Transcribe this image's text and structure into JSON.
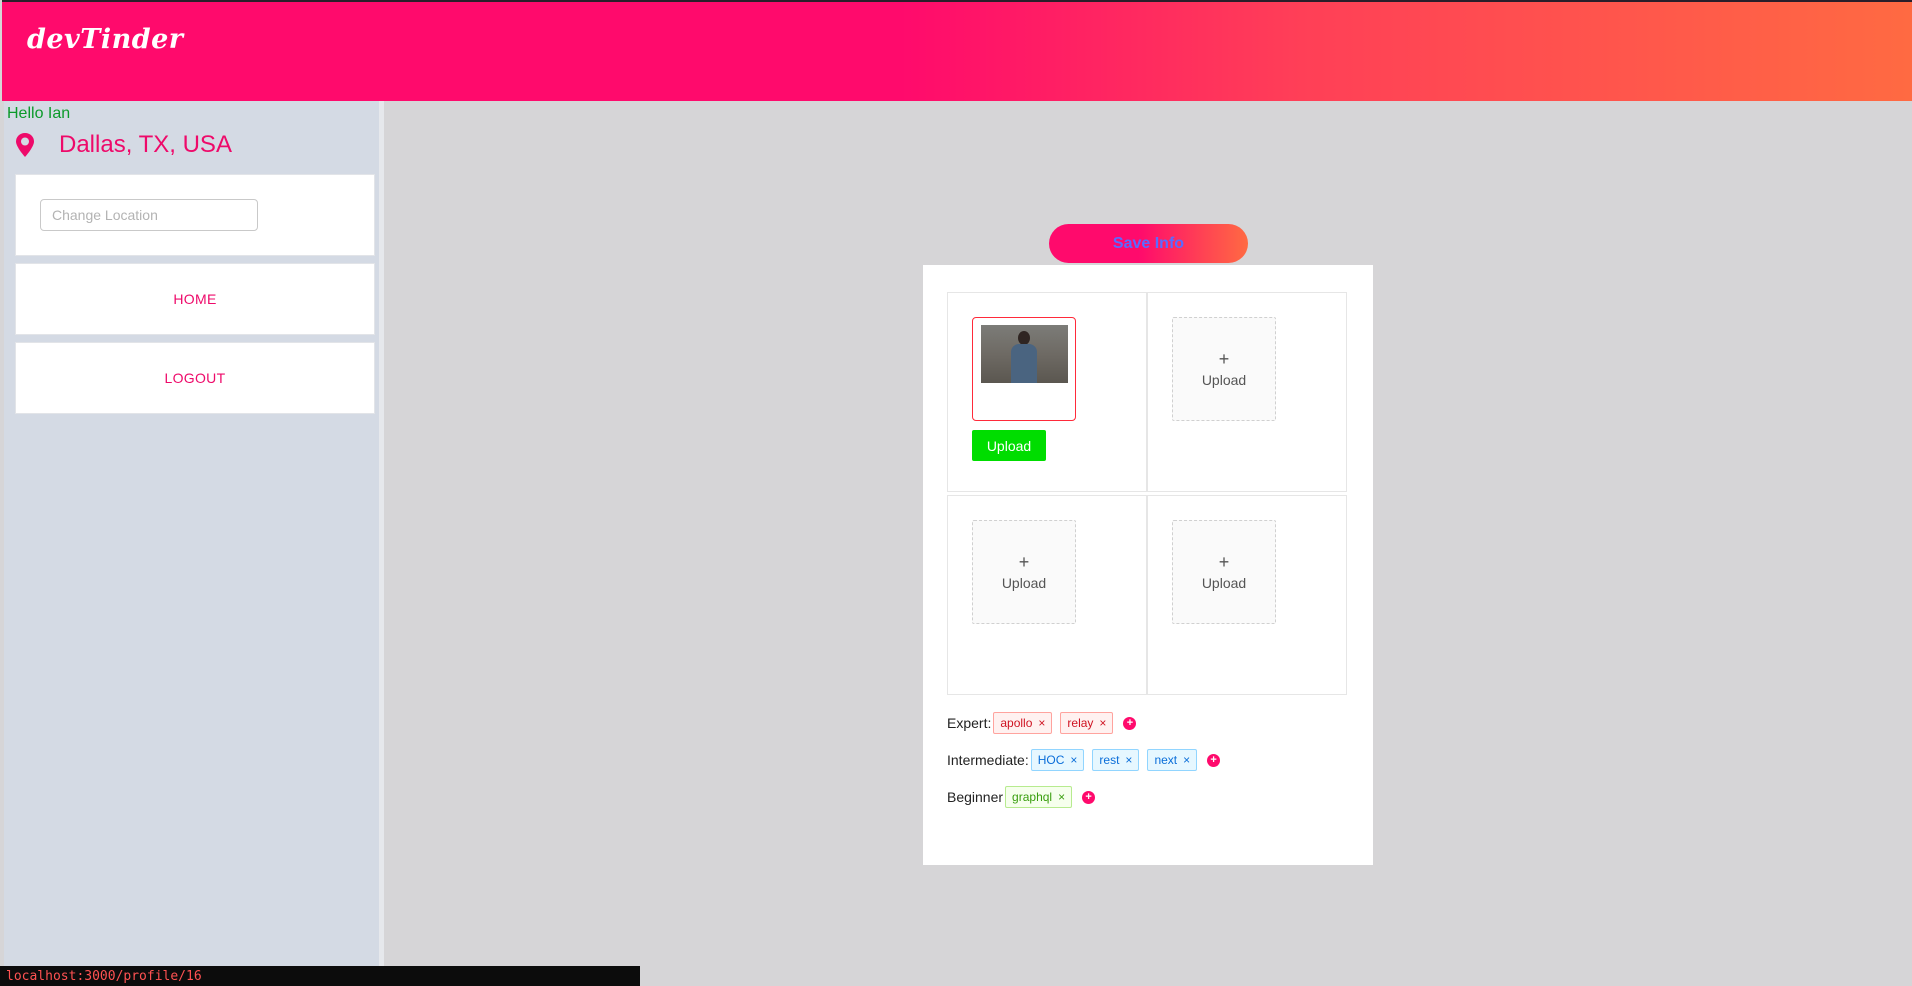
{
  "header": {
    "logo": "devTinder",
    "accent_color": "#ff0a6c"
  },
  "sidebar": {
    "greeting": "Hello Ian",
    "location": "Dallas, TX, USA",
    "location_icon": "map-pin-icon",
    "change_location_placeholder": "Change Location",
    "nav": {
      "home_label": "HOME",
      "logout_label": "LOGOUT"
    }
  },
  "main": {
    "save_label": "Save Info",
    "photos": {
      "upload_button_label": "Upload",
      "slot_upload_label": "Upload",
      "slot_plus": "+"
    },
    "skills": {
      "expert": {
        "label": "Expert:",
        "tags": [
          "apollo",
          "relay"
        ]
      },
      "intermediate": {
        "label": "Intermediate:",
        "tags": [
          "HOC",
          "rest",
          "next"
        ]
      },
      "beginner": {
        "label": "Beginner",
        "tags": [
          "graphql"
        ]
      },
      "remove_glyph": "×",
      "add_glyph": "+"
    }
  },
  "status_bar": {
    "url": "localhost:3000/profile/16"
  }
}
